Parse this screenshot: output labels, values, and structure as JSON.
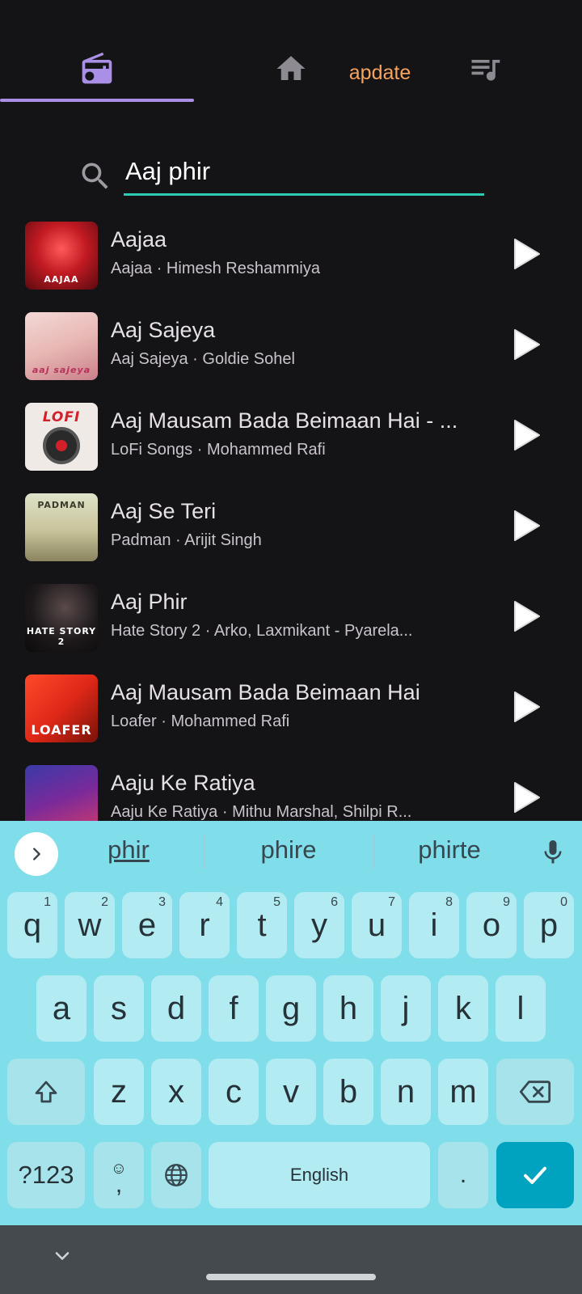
{
  "header": {
    "update_label": "apdate",
    "accent_color": "#a98fe6",
    "icons": [
      "radio-icon",
      "home-icon",
      "queue-music-icon"
    ]
  },
  "search": {
    "value": "Aaj phir",
    "underline_color": "#2ecbb3"
  },
  "results": [
    {
      "title": "Aajaa",
      "subtitle": "Aajaa · Himesh Reshammiya",
      "art_caption": "AAJAA"
    },
    {
      "title": "Aaj Sajeya",
      "subtitle": "Aaj Sajeya · Goldie Sohel",
      "art_caption": "aaj sajeya"
    },
    {
      "title": "Aaj Mausam Bada Beimaan Hai - ...",
      "subtitle": "LoFi Songs · Mohammed Rafi",
      "art_caption": "LOFI"
    },
    {
      "title": "Aaj Se Teri",
      "subtitle": "Padman · Arijit Singh",
      "art_caption": "PADMAN"
    },
    {
      "title": "Aaj Phir",
      "subtitle": "Hate Story 2 · Arko, Laxmikant - Pyarela...",
      "art_caption": "HATE STORY 2"
    },
    {
      "title": "Aaj Mausam Bada Beimaan Hai",
      "subtitle": "Loafer · Mohammed Rafi",
      "art_caption": "LOAFER"
    },
    {
      "title": "Aaju Ke Ratiya",
      "subtitle": "Aaju Ke Ratiya · Mithu Marshal, Shilpi R...",
      "art_caption": ""
    }
  ],
  "keyboard": {
    "suggestions": [
      "phir",
      "phire",
      "phirte"
    ],
    "row1": [
      {
        "key": "q",
        "hint": "1"
      },
      {
        "key": "w",
        "hint": "2"
      },
      {
        "key": "e",
        "hint": "3"
      },
      {
        "key": "r",
        "hint": "4"
      },
      {
        "key": "t",
        "hint": "5"
      },
      {
        "key": "y",
        "hint": "6"
      },
      {
        "key": "u",
        "hint": "7"
      },
      {
        "key": "i",
        "hint": "8"
      },
      {
        "key": "o",
        "hint": "9"
      },
      {
        "key": "p",
        "hint": "0"
      }
    ],
    "row2": [
      "a",
      "s",
      "d",
      "f",
      "g",
      "h",
      "j",
      "k",
      "l"
    ],
    "row3": [
      "z",
      "x",
      "c",
      "v",
      "b",
      "n",
      "m"
    ],
    "symbols_label": "?123",
    "comma_label": ",",
    "space_label": "English",
    "period_label": ".",
    "background_color": "#80deea",
    "enter_color": "#00a3bf"
  }
}
